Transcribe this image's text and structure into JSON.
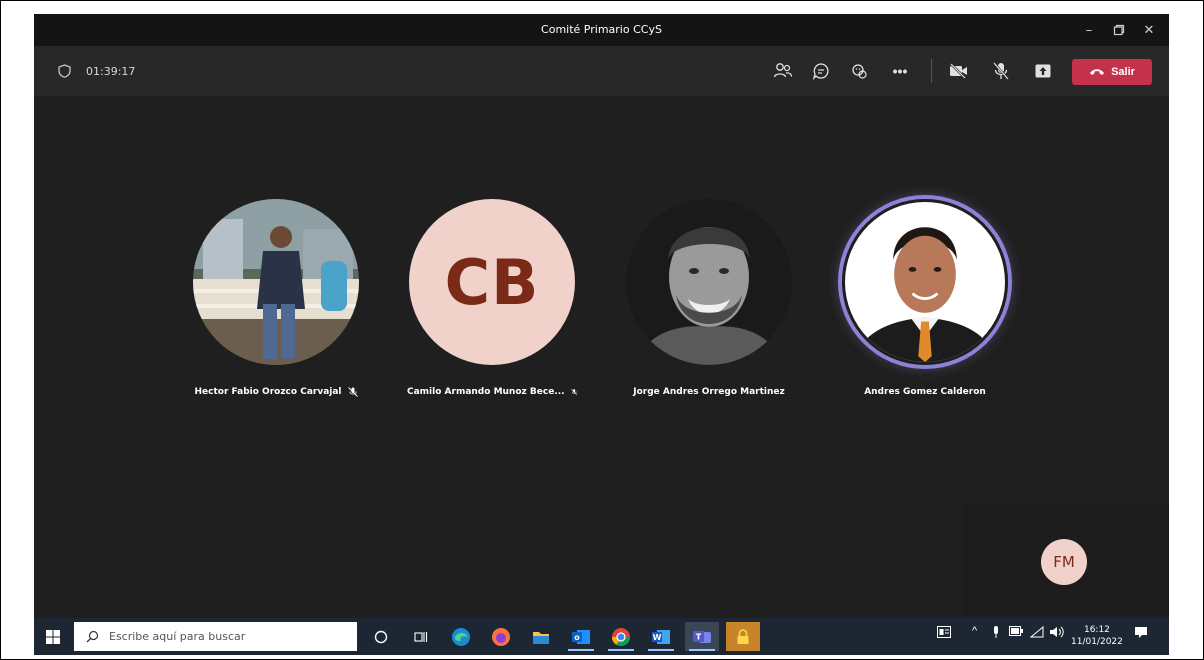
{
  "window": {
    "title": "Comité Primario CCyS",
    "minimize_icon": "minimize-icon",
    "restore_icon": "restore-icon",
    "close_icon": "close-icon"
  },
  "meeting": {
    "duration": "01:39:17",
    "leave_label": "Salir",
    "leave_color": "#c4314b",
    "toolbar_icons": [
      "participants-icon",
      "chat-icon",
      "reactions-icon",
      "more-icon",
      "camera-off-icon",
      "mic-off-icon",
      "share-icon"
    ]
  },
  "participants": [
    {
      "name": "Hector Fabio Orozco Carvajal",
      "muted": true,
      "type": "photo"
    },
    {
      "name": "Camilo Armando Munoz Bece...",
      "muted": true,
      "type": "initials",
      "initials": "CB"
    },
    {
      "name": "Jorge Andres Orrego Martinez",
      "muted": false,
      "type": "photo"
    },
    {
      "name": "Andres Gomez Calderon",
      "muted": false,
      "type": "photo",
      "speaking": true
    }
  ],
  "self_preview": {
    "initials": "FM"
  },
  "taskbar": {
    "search_placeholder": "Escribe aquí para buscar",
    "time": "16:12",
    "date": "11/01/2022",
    "apps": [
      "cortana-icon",
      "task-view-icon",
      "edge-icon",
      "firefox-icon",
      "file-explorer-icon",
      "outlook-icon",
      "chrome-icon",
      "word-icon",
      "teams-icon",
      "lock-app-icon"
    ]
  },
  "colors": {
    "speaking_ring": "#8a83d6",
    "initials_bg": "#f0d2cb",
    "initials_fg": "#7a2a16"
  }
}
